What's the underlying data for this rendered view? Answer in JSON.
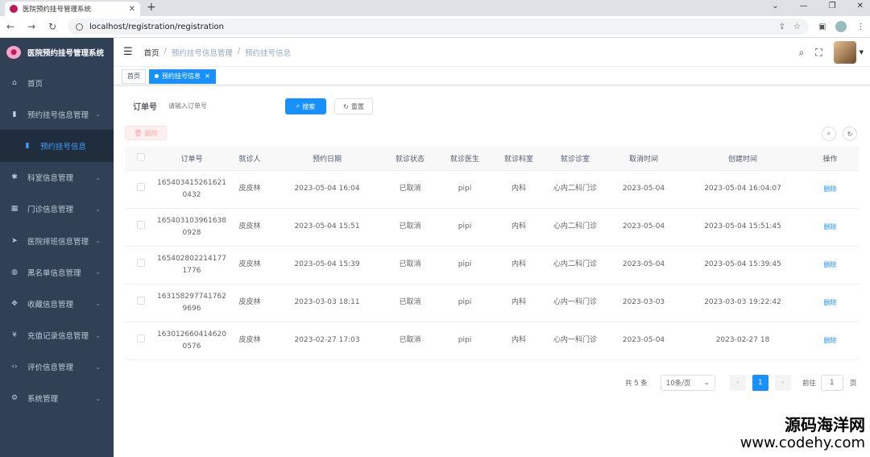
{
  "browser": {
    "tab_title": "医院预约挂号管理系统",
    "new_tab": "+",
    "url": "localhost/registration/registration",
    "window_controls": [
      "⌄",
      "—",
      "❐",
      "✕"
    ]
  },
  "sidebar": {
    "app_name": "医院预约挂号管理系统",
    "items": [
      {
        "icon": "home-icon",
        "glyph": "⌂",
        "label": "首页",
        "has_children": false
      },
      {
        "icon": "chart-icon",
        "glyph": "▮",
        "label": "预约挂号信息管理",
        "has_children": true
      },
      {
        "icon": "chart-icon",
        "glyph": "▮",
        "label": "预约挂号信息",
        "has_children": false,
        "sub": true,
        "active": true
      },
      {
        "icon": "bug-icon",
        "glyph": "✱",
        "label": "科室信息管理",
        "has_children": true
      },
      {
        "icon": "grid-icon",
        "glyph": "▦",
        "label": "门诊信息管理",
        "has_children": true
      },
      {
        "icon": "send-icon",
        "glyph": "➤",
        "label": "医院排班信息管理",
        "has_children": true
      },
      {
        "icon": "globe-icon",
        "glyph": "◍",
        "label": "黑名单信息管理",
        "has_children": true
      },
      {
        "icon": "move-icon",
        "glyph": "✥",
        "label": "收藏信息管理",
        "has_children": true
      },
      {
        "icon": "yen-icon",
        "glyph": "¥",
        "label": "充值记录信息管理",
        "has_children": true
      },
      {
        "icon": "code-icon",
        "glyph": "‹›",
        "label": "评价信息管理",
        "has_children": true
      },
      {
        "icon": "gear-icon",
        "glyph": "⚙",
        "label": "系统管理",
        "has_children": true
      }
    ]
  },
  "navbar": {
    "breadcrumb": [
      "首页",
      "预约挂号信息管理",
      "预约挂号信息"
    ],
    "sep": "/"
  },
  "tags": [
    {
      "label": "首页",
      "active": false
    },
    {
      "label": "预约挂号信息",
      "active": true
    }
  ],
  "search": {
    "label": "订单号",
    "placeholder": "请输入订单号",
    "search_button": "搜索",
    "reset_button": "重置",
    "delete_button": "删除"
  },
  "table": {
    "columns": [
      "订单号",
      "就诊人",
      "预约日期",
      "就诊状态",
      "就诊医生",
      "就诊科室",
      "就诊诊室",
      "取消时间",
      "创建时间",
      "操作"
    ],
    "action_label": "删除",
    "rows": [
      {
        "order": "1654034152616210432",
        "patient": "皮皮林",
        "date": "2023-05-04 16:04",
        "status": "已取消",
        "doctor": "pipi",
        "dept": "内科",
        "room": "心内二科门诊",
        "cancel": "2023-05-04",
        "created": "2023-05-04 16:04:07"
      },
      {
        "order": "1654031039616380928",
        "patient": "皮皮林",
        "date": "2023-05-04 15:51",
        "status": "已取消",
        "doctor": "pipi",
        "dept": "内科",
        "room": "心内二科门诊",
        "cancel": "2023-05-04",
        "created": "2023-05-04 15:51:45"
      },
      {
        "order": "1654028022141771776",
        "patient": "皮皮林",
        "date": "2023-05-04 15:39",
        "status": "已取消",
        "doctor": "pipi",
        "dept": "内科",
        "room": "心内二科门诊",
        "cancel": "2023-05-04",
        "created": "2023-05-04 15:39:45"
      },
      {
        "order": "1631582977417629696",
        "patient": "皮皮林",
        "date": "2023-03-03 18:11",
        "status": "已取消",
        "doctor": "pipi",
        "dept": "内科",
        "room": "心内一科门诊",
        "cancel": "2023-03-03",
        "created": "2023-03-03 19:22:42"
      },
      {
        "order": "1630126604146200576",
        "patient": "皮皮林",
        "date": "2023-02-27 17:03",
        "status": "已取消",
        "doctor": "pipi",
        "dept": "内科",
        "room": "心内一科门诊",
        "cancel": "2023-05-04",
        "created": "2023-02-27 18"
      }
    ]
  },
  "pager": {
    "total": "共 5 条",
    "page_size": "10条/页",
    "current_page": "1",
    "goto_label": "前往",
    "goto_value": "1",
    "page_unit": "页"
  },
  "watermark": {
    "line1": "源码海洋网",
    "line2": "www.codehy.com"
  }
}
